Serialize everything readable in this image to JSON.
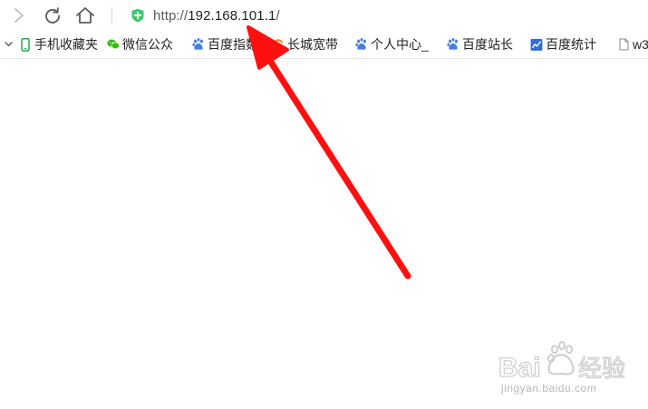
{
  "address_bar": {
    "url_scheme": "http://",
    "url_host": "192.168.101.1",
    "url_path": "/"
  },
  "bookmarks": [
    {
      "label": "手机收藏夹",
      "icon": "phone-icon"
    },
    {
      "label": "微信公众",
      "icon": "wechat-icon"
    },
    {
      "label": "百度指数",
      "icon": "baidu-paw-icon"
    },
    {
      "label": "长城宽带",
      "icon": "greatwall-broadband-icon"
    },
    {
      "label": "个人中心_",
      "icon": "baidu-paw-icon"
    },
    {
      "label": "百度站长",
      "icon": "baidu-paw-icon"
    },
    {
      "label": "百度统计",
      "icon": "chart-icon"
    },
    {
      "label": "w3",
      "icon": "page-icon"
    }
  ],
  "colors": {
    "arrow": "#ff1010",
    "secure_shield": "#37c96b",
    "baidu_blue": "#3f7fe0",
    "wechat_green": "#2dc100"
  },
  "watermark": {
    "brand": "Bai度经验",
    "domain": "jingyan.baidu.com"
  }
}
